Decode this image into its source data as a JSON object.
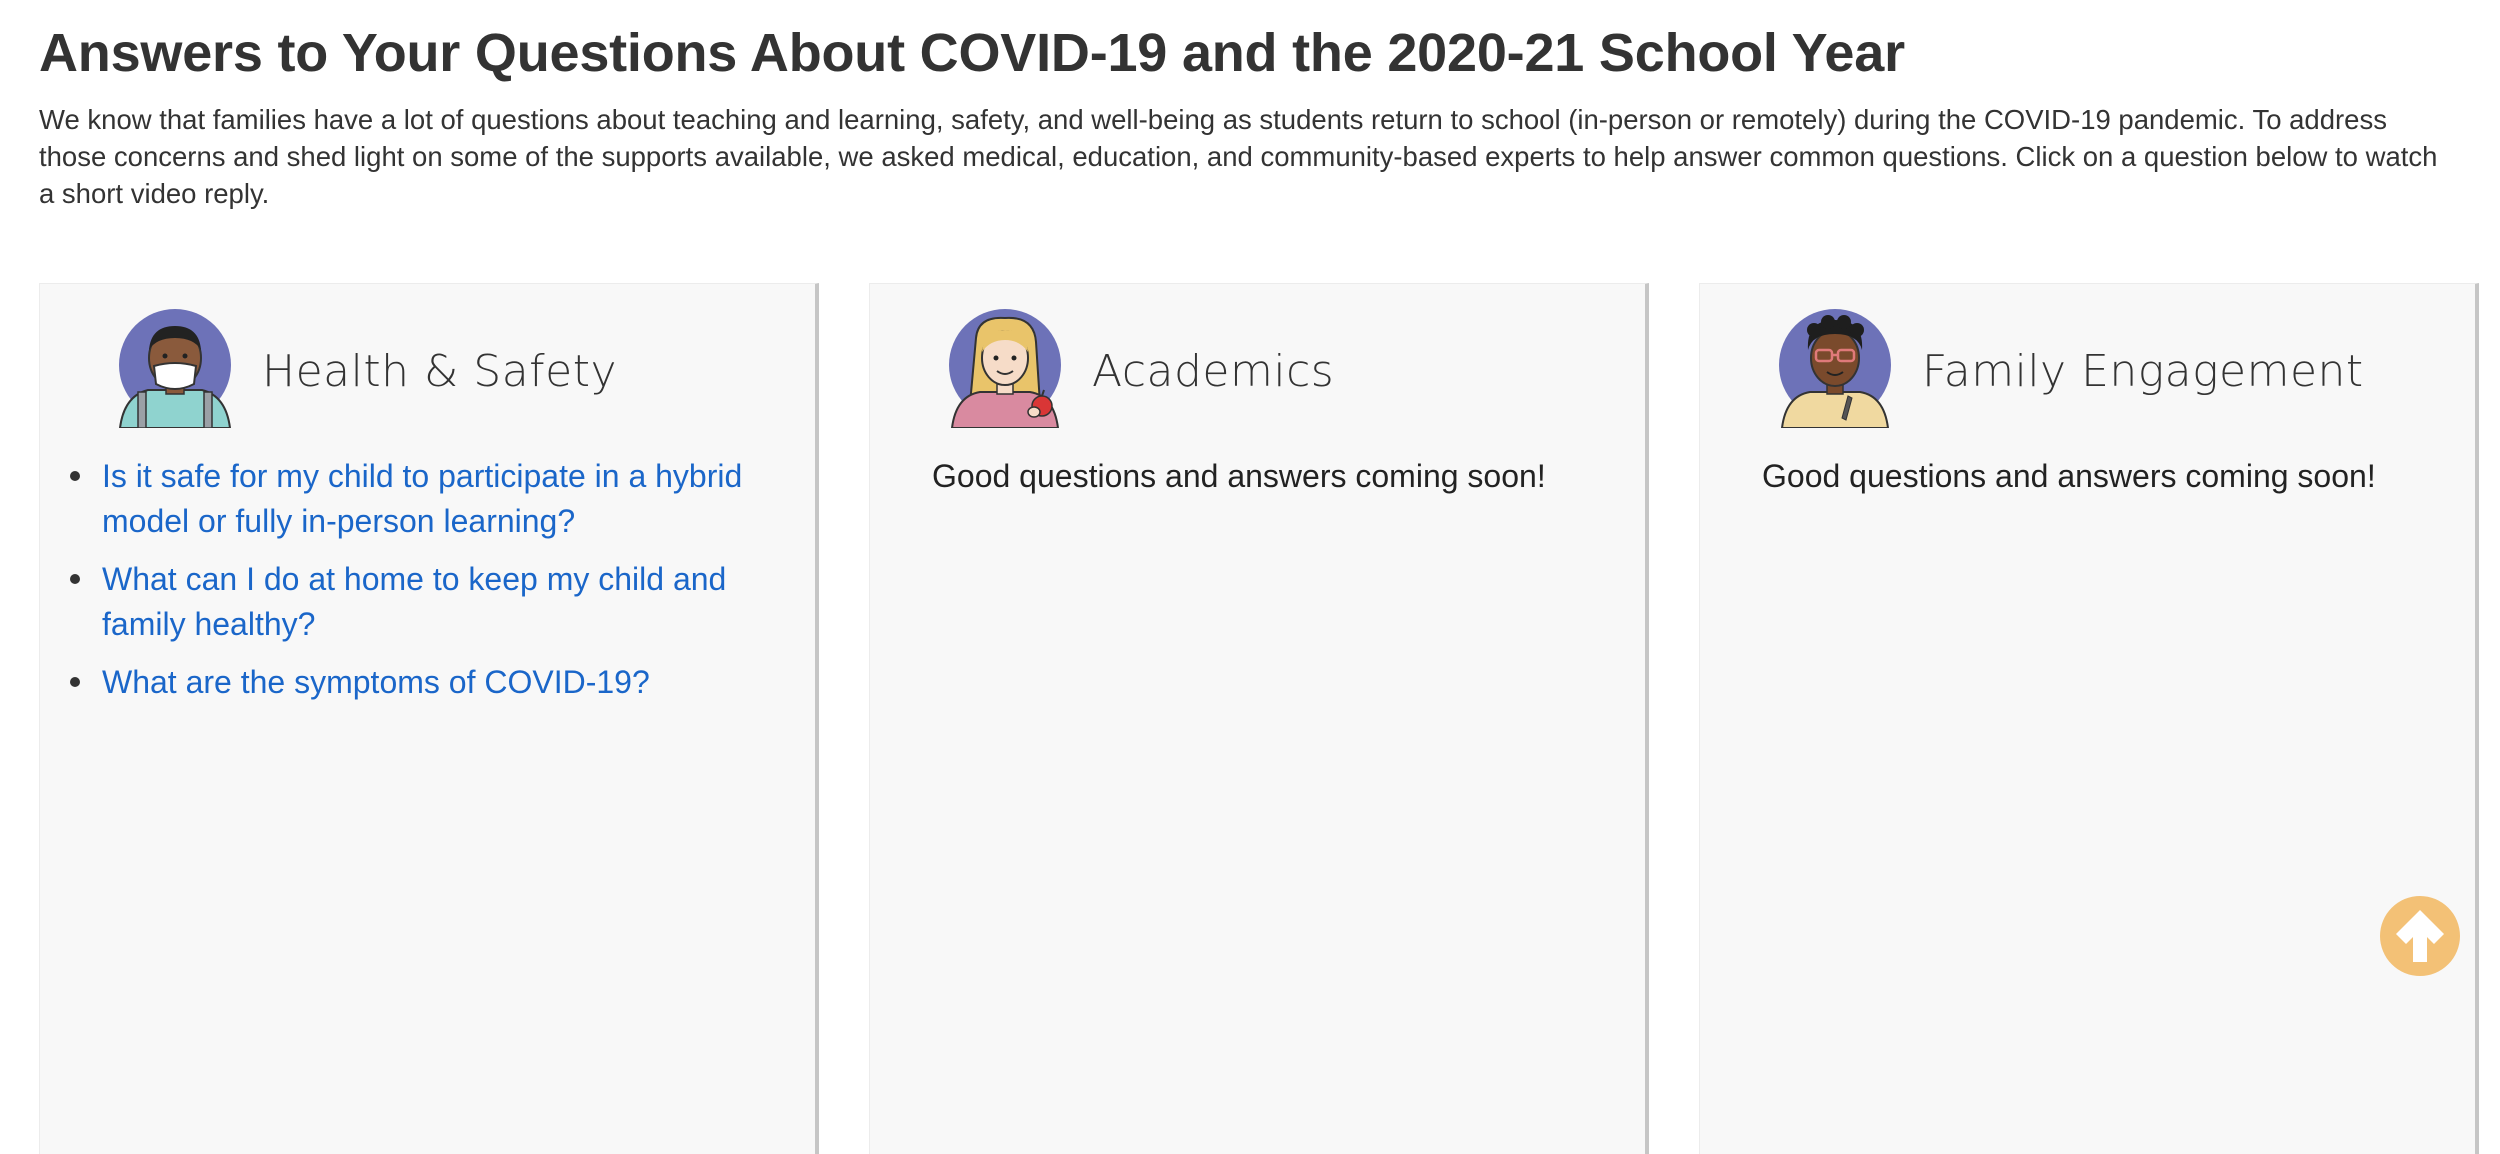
{
  "page": {
    "title": "Answers to Your Questions About COVID-19 and the 2020-21 School Year",
    "intro": "We know that families have a lot of questions about teaching and learning, safety, and well-being as students return to school (in-person or remotely) during the COVID-19 pandemic. To address those concerns and shed light on some of the supports available, we asked medical, education, and community-based experts to help answer common questions. Click on a question below to watch a short video reply."
  },
  "cards": {
    "health": {
      "title": "Health & Safety",
      "avatar_icon": "masked-student-avatar-icon",
      "questions": [
        "Is it safe for my child to participate in a hybrid model or fully in-person learning?",
        "What can I do at home to keep my child and family healthy?",
        "What are the symptoms of COVID-19?"
      ]
    },
    "academics": {
      "title": "Academics",
      "avatar_icon": "student-with-apple-avatar-icon",
      "message": "Good questions and answers coming soon!"
    },
    "family": {
      "title": "Family Engagement",
      "avatar_icon": "student-with-glasses-avatar-icon",
      "message": "Good questions and answers coming soon!"
    }
  },
  "scroll_top": {
    "icon": "arrow-up-icon"
  },
  "colors": {
    "link": "#1a66c9",
    "card_bg": "#f8f8f8",
    "avatar_bg": "#6d72b8",
    "scroll_top_bg": "#f3c176"
  }
}
